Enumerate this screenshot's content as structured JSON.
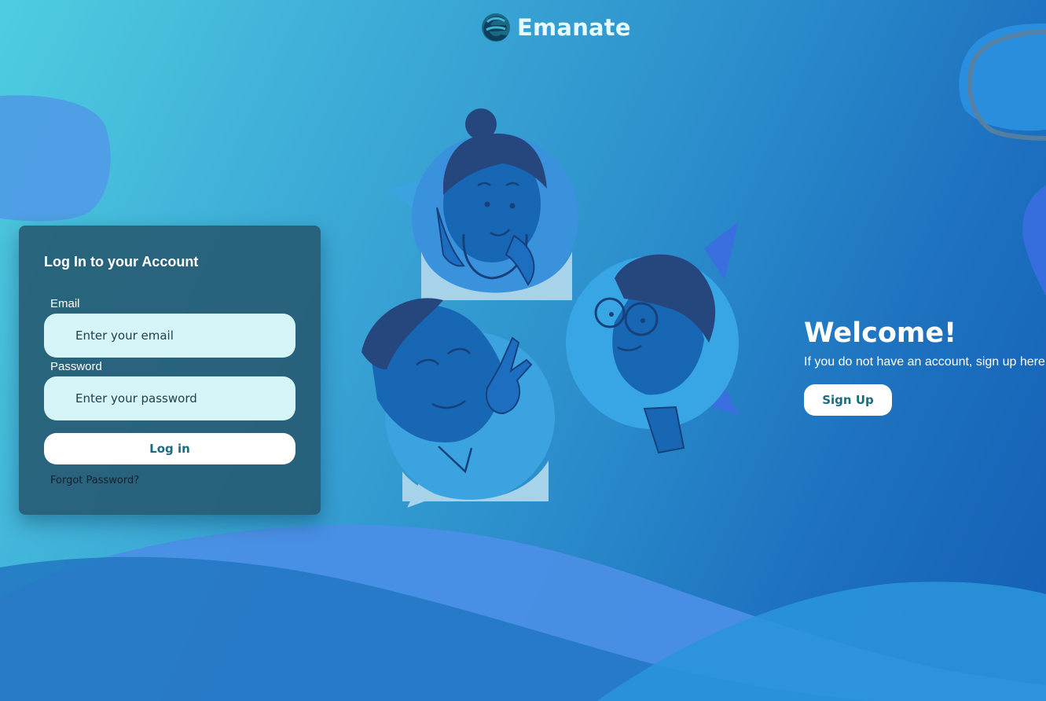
{
  "brand": {
    "name": "Emanate",
    "logo_icon": "emanate-logo-icon"
  },
  "login": {
    "title": "Log In to your Account",
    "email_label": "Email",
    "email_placeholder": "Enter your email",
    "email_value": "",
    "password_label": "Password",
    "password_placeholder": "Enter your password",
    "password_value": "",
    "login_button": "Log in",
    "forgot_password": "Forgot Password?"
  },
  "welcome": {
    "title": "Welcome!",
    "subtitle": "If you do not have an account, sign up here",
    "signup_button": "Sign Up"
  },
  "illustration": {
    "icon": "people-chat-illustration-icon"
  },
  "colors": {
    "background_start": "#4fcde0",
    "background_end": "#145fb6",
    "card": "#265870",
    "input_fill": "#d5f4f7",
    "button_text": "#1d6b7f",
    "button_fill": "#ffffff"
  }
}
